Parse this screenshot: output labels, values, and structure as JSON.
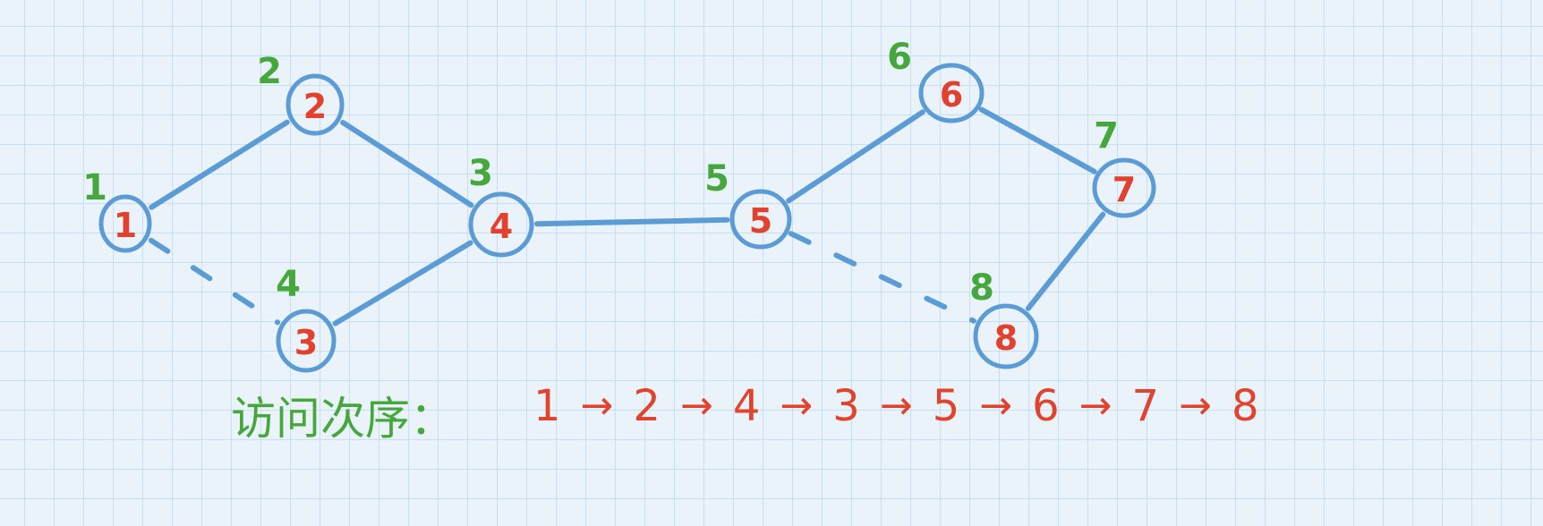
{
  "colors": {
    "paper": "#eaf2fa",
    "grid": "#c8dff1",
    "edge": "#5b9bd6",
    "node_label": "#e2412e",
    "order_label": "#46a83c",
    "sequence": "#e0442f"
  },
  "graph": {
    "nodes": [
      {
        "label": "1",
        "visit_order": "1"
      },
      {
        "label": "2",
        "visit_order": "2"
      },
      {
        "label": "3",
        "visit_order": "4"
      },
      {
        "label": "4",
        "visit_order": "3"
      },
      {
        "label": "5",
        "visit_order": "5"
      },
      {
        "label": "6",
        "visit_order": "6"
      },
      {
        "label": "7",
        "visit_order": "7"
      },
      {
        "label": "8",
        "visit_order": "8"
      }
    ],
    "edges": [
      {
        "from": 1,
        "to": 2,
        "dashed": false
      },
      {
        "from": 1,
        "to": 3,
        "dashed": true
      },
      {
        "from": 2,
        "to": 4,
        "dashed": false
      },
      {
        "from": 3,
        "to": 4,
        "dashed": false
      },
      {
        "from": 4,
        "to": 5,
        "dashed": false
      },
      {
        "from": 5,
        "to": 6,
        "dashed": false
      },
      {
        "from": 5,
        "to": 8,
        "dashed": true
      },
      {
        "from": 6,
        "to": 7,
        "dashed": false
      },
      {
        "from": 7,
        "to": 8,
        "dashed": false
      }
    ]
  },
  "visit_order": {
    "label": "访问次序：",
    "sequence": [
      "1",
      "2",
      "4",
      "3",
      "5",
      "6",
      "7",
      "8"
    ],
    "arrow": "→"
  }
}
